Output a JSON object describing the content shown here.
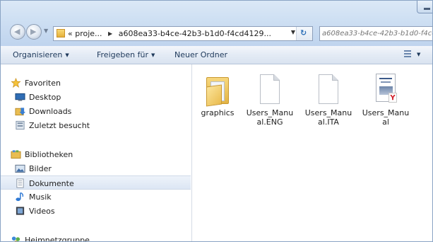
{
  "address": {
    "chevron": "«",
    "segments": [
      "proje...",
      "a608ea33-b4ce-42b3-b1d0-f4cd4129..."
    ],
    "dropdown_icon": "chevron-down-icon",
    "refresh_icon": "refresh-icon"
  },
  "search": {
    "placeholder": "a608ea33-b4ce-42b3-b1d0-f4cd4129..."
  },
  "toolbar": {
    "organize_label": "Organisieren",
    "share_label": "Freigeben für",
    "new_folder_label": "Neuer Ordner"
  },
  "nav": {
    "favorites": {
      "label": "Favoriten",
      "items": [
        {
          "label": "Desktop",
          "icon": "desktop-icon"
        },
        {
          "label": "Downloads",
          "icon": "downloads-icon"
        },
        {
          "label": "Zuletzt besucht",
          "icon": "recent-places-icon"
        }
      ]
    },
    "libraries": {
      "label": "Bibliotheken",
      "items": [
        {
          "label": "Bilder",
          "icon": "pictures-icon"
        },
        {
          "label": "Dokumente",
          "icon": "documents-icon",
          "selected": true
        },
        {
          "label": "Musik",
          "icon": "music-icon"
        },
        {
          "label": "Videos",
          "icon": "videos-icon"
        }
      ]
    },
    "homegroup": {
      "label": "Heimnetzgruppe"
    }
  },
  "files": [
    {
      "name": "graphics",
      "type": "folder"
    },
    {
      "name": "Users_Manual.ENG",
      "type": "file"
    },
    {
      "name": "Users_Manual.ITA",
      "type": "file"
    },
    {
      "name": "Users_Manual",
      "type": "pdf"
    }
  ],
  "colors": {
    "titlebar": "#cfe0f3",
    "toolbar": "#e4ebf5",
    "selection": "#dce6f4",
    "folder": "#e9bd52"
  }
}
